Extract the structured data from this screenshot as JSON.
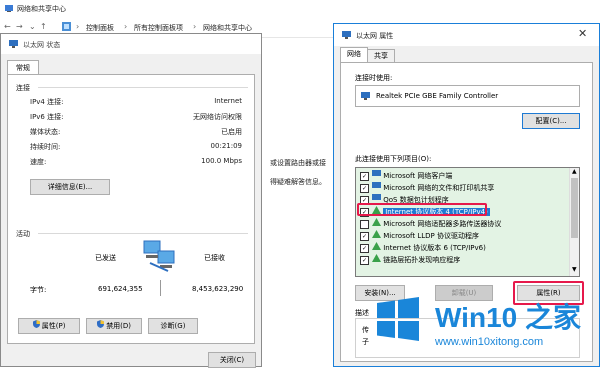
{
  "background_window": {
    "title": "网络和共享中心",
    "breadcrumb": [
      "控制面板",
      "所有控制面板项",
      "网络和共享中心"
    ],
    "partial_text_1": "或设置路由器或接",
    "partial_text_2": "得疑难解答信息。"
  },
  "status_dialog": {
    "title": "以太网 状态",
    "tab": "常规",
    "connection_section": "连接",
    "rows": [
      {
        "label": "IPv4 连接:",
        "value": "Internet"
      },
      {
        "label": "IPv6 连接:",
        "value": "无网络访问权限"
      },
      {
        "label": "媒体状态:",
        "value": "已启用"
      },
      {
        "label": "持续时间:",
        "value": "00:21:09"
      },
      {
        "label": "速度:",
        "value": "100.0 Mbps"
      }
    ],
    "details_button": "详细信息(E)...",
    "activity_section": "活动",
    "sent_label": "已发送",
    "received_label": "已接收",
    "bytes_label": "字节:",
    "bytes_sent": "691,624,355",
    "bytes_received": "8,453,623,290",
    "properties_button": "属性(P)",
    "disable_button": "禁用(D)",
    "diagnose_button": "诊断(G)",
    "close_button": "关闭(C)"
  },
  "properties_dialog": {
    "title": "以太网 属性",
    "tabs": [
      "网络",
      "共享"
    ],
    "connect_using_label": "连接时使用:",
    "adapter_name": "Realtek PCIe GBE Family Controller",
    "configure_button": "配置(C)...",
    "items_label": "此连接使用下列项目(O):",
    "items": [
      {
        "label": "Microsoft 网络客户端",
        "checked": true
      },
      {
        "label": "Microsoft 网络的文件和打印机共享",
        "checked": true
      },
      {
        "label": "QoS 数据包计划程序",
        "checked": true
      },
      {
        "label": "Internet 协议版本 4 (TCP/IPv4)",
        "checked": true,
        "selected": true
      },
      {
        "label": "Microsoft 网络适配器多路传送器协议",
        "checked": false
      },
      {
        "label": "Microsoft LLDP 协议驱动程序",
        "checked": true
      },
      {
        "label": "Internet 协议版本 6 (TCP/IPv6)",
        "checked": true
      },
      {
        "label": "链路层拓扑发现响应程序",
        "checked": true
      }
    ],
    "install_button": "安装(N)...",
    "uninstall_button": "卸载(U)",
    "properties_button": "属性(R)",
    "description_label": "描述",
    "description_text_1": "传",
    "description_text_2": "子"
  },
  "watermark": {
    "brand": "Win10 之家",
    "url": "www.win10xitong.com"
  },
  "colors": {
    "highlight": "#1e7ad3",
    "annotation_red": "#e6194b",
    "list_background": "#e3f3e4",
    "brand_blue": "#1a86d9"
  }
}
